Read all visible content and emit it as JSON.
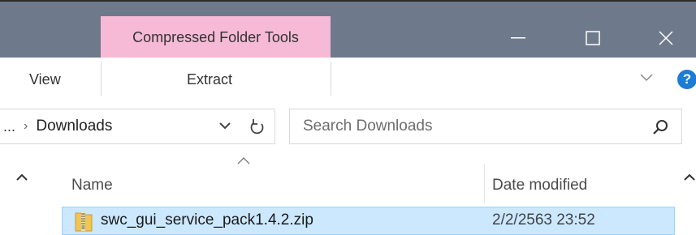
{
  "titlebar": {
    "contextual_tab": "Compressed Folder Tools",
    "icons": {
      "minimize": "minimize-icon",
      "maximize": "maximize-icon",
      "close": "close-icon"
    },
    "colors": {
      "bar": "#6e7a8b",
      "contextual": "#f6b9d6"
    }
  },
  "ribbon": {
    "tab_view": "View",
    "tab_extract": "Extract"
  },
  "address": {
    "prefix": "...",
    "current_folder": "Downloads",
    "search_placeholder": "Search Downloads"
  },
  "columns": {
    "name": "Name",
    "date_modified": "Date modified"
  },
  "files": [
    {
      "name": "swc_gui_service_pack1.4.2.zip",
      "date_modified": "2/2/2563 23:52",
      "selected": true
    }
  ]
}
